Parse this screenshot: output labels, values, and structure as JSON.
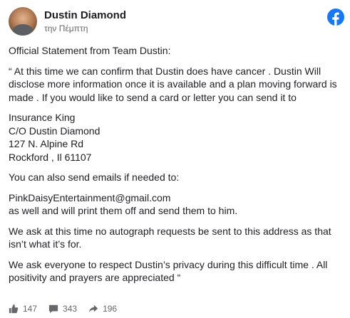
{
  "header": {
    "author": "Dustin Diamond",
    "time": "την Πέμπτη",
    "avatar_icon": "avatar-photo",
    "logo_icon": "facebook-logo-icon",
    "brand_color": "#1877f2"
  },
  "post": {
    "paragraphs": [
      "Official Statement from Team Dustin:",
      "“ At this time we can confirm that Dustin does have cancer . Dustin Will disclose more information once it is available and a plan moving forward is made . If you would like to send a card or letter you can send it to"
    ],
    "address": [
      "Insurance King",
      "C/O Dustin Diamond",
      "127 N. Alpine Rd",
      "Rockford , Il 61107"
    ],
    "email_intro": "You can also send emails if needed to:",
    "email_block": [
      "PinkDaisyEntertainment@gmail.com",
      "as well and will print them off and send them to him."
    ],
    "closing": [
      "We ask at this time no autograph requests be sent to this address as that isn’t what it’s for.",
      "We ask everyone to respect Dustin’s privacy during this difficult time . All positivity and prayers are appreciated “"
    ]
  },
  "footer": {
    "likes": "147",
    "comments": "343",
    "shares": "196",
    "icon_color": "#65676b"
  }
}
